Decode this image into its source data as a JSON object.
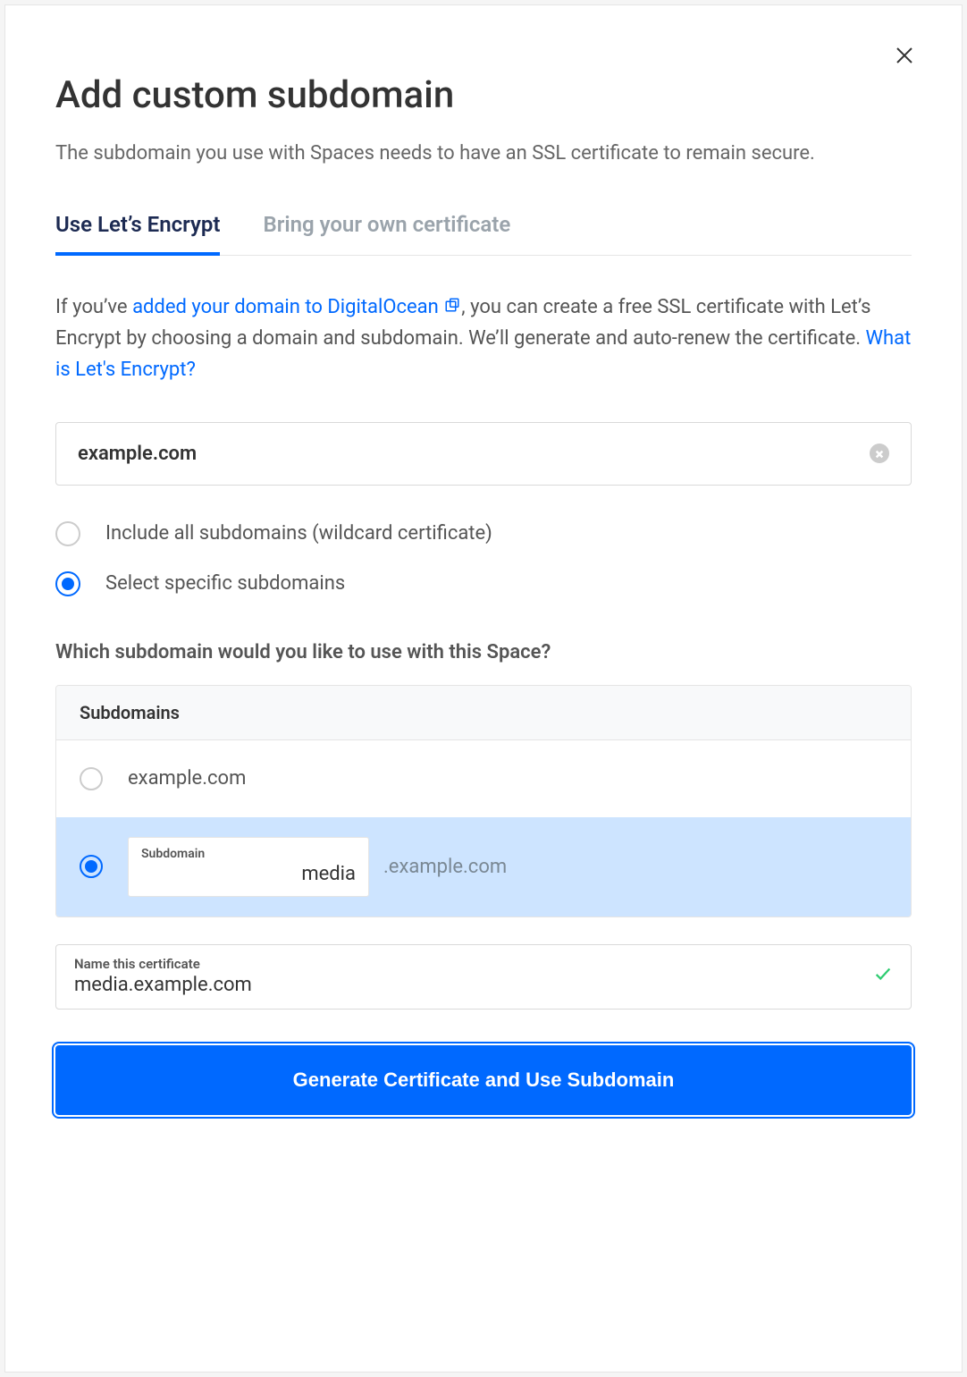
{
  "modal": {
    "title": "Add custom subdomain",
    "subtitle": "The subdomain you use with Spaces needs to have an SSL certificate to remain secure."
  },
  "tabs": {
    "lets_encrypt": "Use Let’s Encrypt",
    "byoc": "Bring your own certificate"
  },
  "description": {
    "part1": "If you’ve ",
    "link1": "added your domain to DigitalOcean",
    "part2": ", you can create a free SSL certificate with Let’s Encrypt by choosing a domain and subdomain. We’ll generate and auto-renew the certificate. ",
    "link2": "What is Let's Encrypt?"
  },
  "domain_input": {
    "value": "example.com"
  },
  "cert_scope": {
    "wildcard": "Include all subdomains (wildcard certificate)",
    "specific": "Select specific subdomains"
  },
  "subdomain_section": {
    "question": "Which subdomain would you like to use with this Space?",
    "header": "Subdomains",
    "apex": "example.com",
    "sub_input_label": "Subdomain",
    "sub_input_value": "media",
    "sub_suffix": ".example.com"
  },
  "cert_name": {
    "label": "Name this certificate",
    "value": "media.example.com"
  },
  "actions": {
    "submit": "Generate Certificate and Use Subdomain"
  }
}
